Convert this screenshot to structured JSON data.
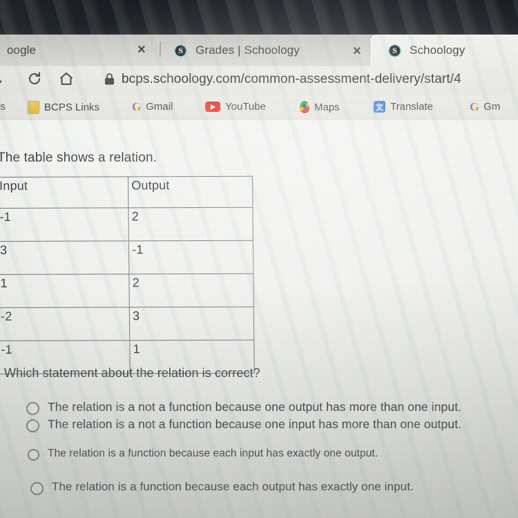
{
  "browser": {
    "tabs": [
      {
        "title": "oogle",
        "favicon": "none",
        "active": false,
        "close_label": "×"
      },
      {
        "title": "Grades | Schoology",
        "favicon": "schoology-favicon",
        "active": false,
        "close_label": "×"
      },
      {
        "title": "Schoology",
        "favicon": "schoology-favicon",
        "active": true,
        "close_label": ""
      }
    ],
    "toolbar": {
      "reload_icon": "reload-icon",
      "home_icon": "home-icon",
      "back_icon": "back-arrow-icon",
      "lock_icon": "lock-icon",
      "url": "bcps.schoology.com/common-assessment-delivery/start/4"
    },
    "bookmarks": [
      {
        "label": "ps",
        "icon": "apps-icon"
      },
      {
        "label": "BCPS Links",
        "icon": "folder-icon"
      },
      {
        "label": "Gmail",
        "icon": "google-g-icon"
      },
      {
        "label": "YouTube",
        "icon": "youtube-icon"
      },
      {
        "label": "Maps",
        "icon": "maps-pin-icon"
      },
      {
        "label": "Translate",
        "icon": "translate-icon"
      },
      {
        "label": "Gm",
        "icon": "google-g-icon"
      }
    ]
  },
  "question": {
    "stem": "The table shows a relation.",
    "prompt": "Which statement about the relation is correct?",
    "table": {
      "headers": [
        "Input",
        "Output"
      ],
      "rows": [
        [
          "-1",
          "2"
        ],
        [
          "3",
          "-1"
        ],
        [
          "1",
          "2"
        ],
        [
          "-2",
          "3"
        ],
        [
          "-1",
          "1"
        ]
      ]
    },
    "options": [
      "The relation is a not a function because one output has more than one input.",
      "The relation is a not a function because one input has more than one output.",
      "The relation is a function because each input has exactly one output.",
      "The relation is a function because each output has exactly one input."
    ]
  },
  "colors": {
    "chrome_dark": "#1b1f24",
    "page_bg": "#f3f4f1",
    "table_border": "#6d7175",
    "text": "#3a3e42"
  }
}
